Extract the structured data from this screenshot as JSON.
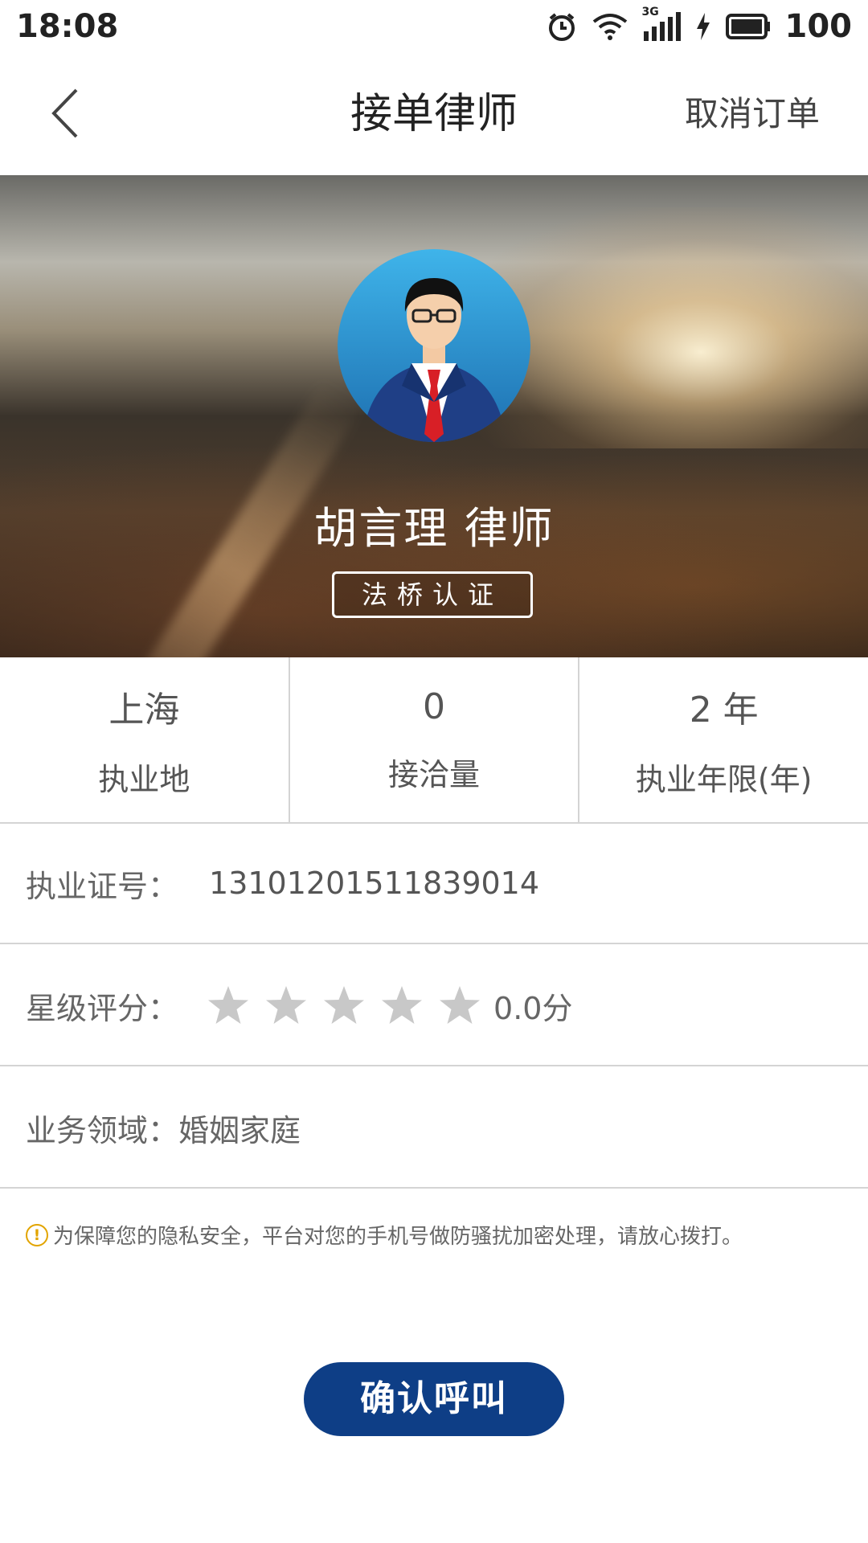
{
  "status_bar": {
    "time": "18:08",
    "network": "3G",
    "battery": "100"
  },
  "nav": {
    "title": "接单律师",
    "cancel_label": "取消订单"
  },
  "profile": {
    "name": "胡言理  律师",
    "badge": "法桥认证"
  },
  "stats": [
    {
      "value": "上海",
      "label": "执业地"
    },
    {
      "value": "0",
      "label": "接洽量"
    },
    {
      "value": "2 年",
      "label": "执业年限(年)"
    }
  ],
  "license": {
    "label": "执业证号：",
    "value": "13101201511839014"
  },
  "rating": {
    "label": "星级评分：",
    "score": "0.0分",
    "stars_filled": 0,
    "stars_total": 5
  },
  "field": {
    "label": "业务领域：",
    "value": "婚姻家庭"
  },
  "notice": {
    "text": "为保障您的隐私安全，平台对您的手机号做防骚扰加密处理，请放心拨打。"
  },
  "confirm_label": "确认呼叫",
  "colors": {
    "primary": "#0e3e86",
    "warning": "#e2a400",
    "star_empty": "#c8c8c8"
  }
}
